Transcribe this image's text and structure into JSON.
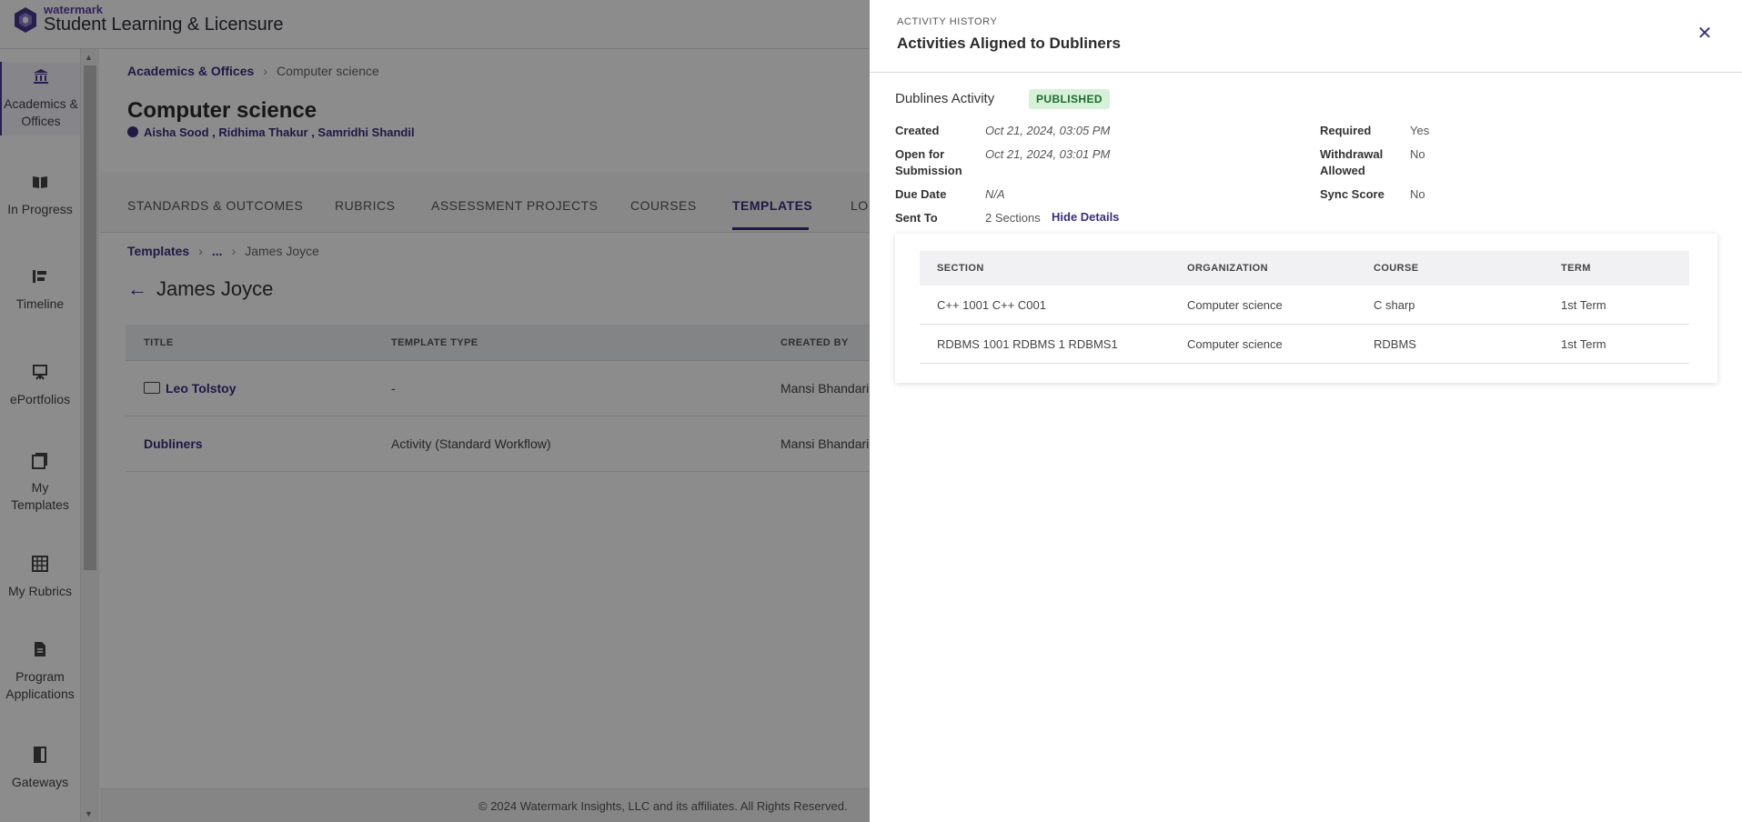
{
  "header": {
    "brand_small": "watermark",
    "brand_big": "Student Learning & Licensure"
  },
  "sidenav": {
    "items": [
      {
        "label": "Academics & Offices",
        "icon": "bank-icon"
      },
      {
        "label": "In Progress",
        "icon": "book-open-icon"
      },
      {
        "label": "Timeline",
        "icon": "timeline-icon"
      },
      {
        "label": "ePortfolios",
        "icon": "easel-icon"
      },
      {
        "label": "My Templates",
        "icon": "templates-icon"
      },
      {
        "label": "My Rubrics",
        "icon": "grid-icon"
      },
      {
        "label": "Program Applications",
        "icon": "document-icon"
      },
      {
        "label": "Gateways",
        "icon": "door-icon"
      }
    ]
  },
  "main": {
    "breadcrumb": {
      "root": "Academics & Offices",
      "current": "Computer science"
    },
    "title": "Computer science",
    "people": "Aisha Sood , Ridhima Thakur , Samridhi Shandil",
    "tabs": [
      "STANDARDS & OUTCOMES",
      "RUBRICS",
      "ASSESSMENT PROJECTS",
      "COURSES",
      "TEMPLATES",
      "LO"
    ],
    "active_tab": "TEMPLATES",
    "breadcrumb2": {
      "root": "Templates",
      "mid": "...",
      "current": "James Joyce"
    },
    "folder_title": "James Joyce",
    "table": {
      "headers": [
        "TITLE",
        "TEMPLATE TYPE",
        "CREATED BY"
      ],
      "rows": [
        {
          "title": "Leo Tolstoy",
          "type": "-",
          "created_by": "Mansi Bhandari"
        },
        {
          "title": "Dubliners",
          "type": "Activity (Standard Workflow)",
          "created_by": "Mansi Bhandari"
        }
      ]
    },
    "footer": "© 2024 Watermark Insights, LLC and its affiliates. All Rights Reserved."
  },
  "drawer": {
    "kicker": "ACTIVITY HISTORY",
    "title": "Activities Aligned to Dubliners",
    "activity_name": "Dublines Activity",
    "status": "PUBLISHED",
    "fields_left": [
      {
        "label": "Created",
        "value": "Oct 21, 2024, 03:05 PM"
      },
      {
        "label": "Open for Submission",
        "value": "Oct 21, 2024, 03:01 PM"
      },
      {
        "label": "Due Date",
        "value": "N/A"
      },
      {
        "label": "Sent To",
        "value": "2 Sections"
      }
    ],
    "hide_details": "Hide Details",
    "fields_right": [
      {
        "label": "Required",
        "value": "Yes"
      },
      {
        "label": "Withdrawal Allowed",
        "value": "No"
      },
      {
        "label": "Sync Score",
        "value": "No"
      }
    ],
    "sections_table": {
      "headers": [
        "SECTION",
        "ORGANIZATION",
        "COURSE",
        "TERM"
      ],
      "rows": [
        [
          "C++ 1001 C++ C001",
          "Computer science",
          "C sharp",
          "1st Term"
        ],
        [
          "RDBMS 1001 RDBMS 1 RDBMS1",
          "Computer science",
          "RDBMS",
          "1st Term"
        ]
      ]
    }
  }
}
